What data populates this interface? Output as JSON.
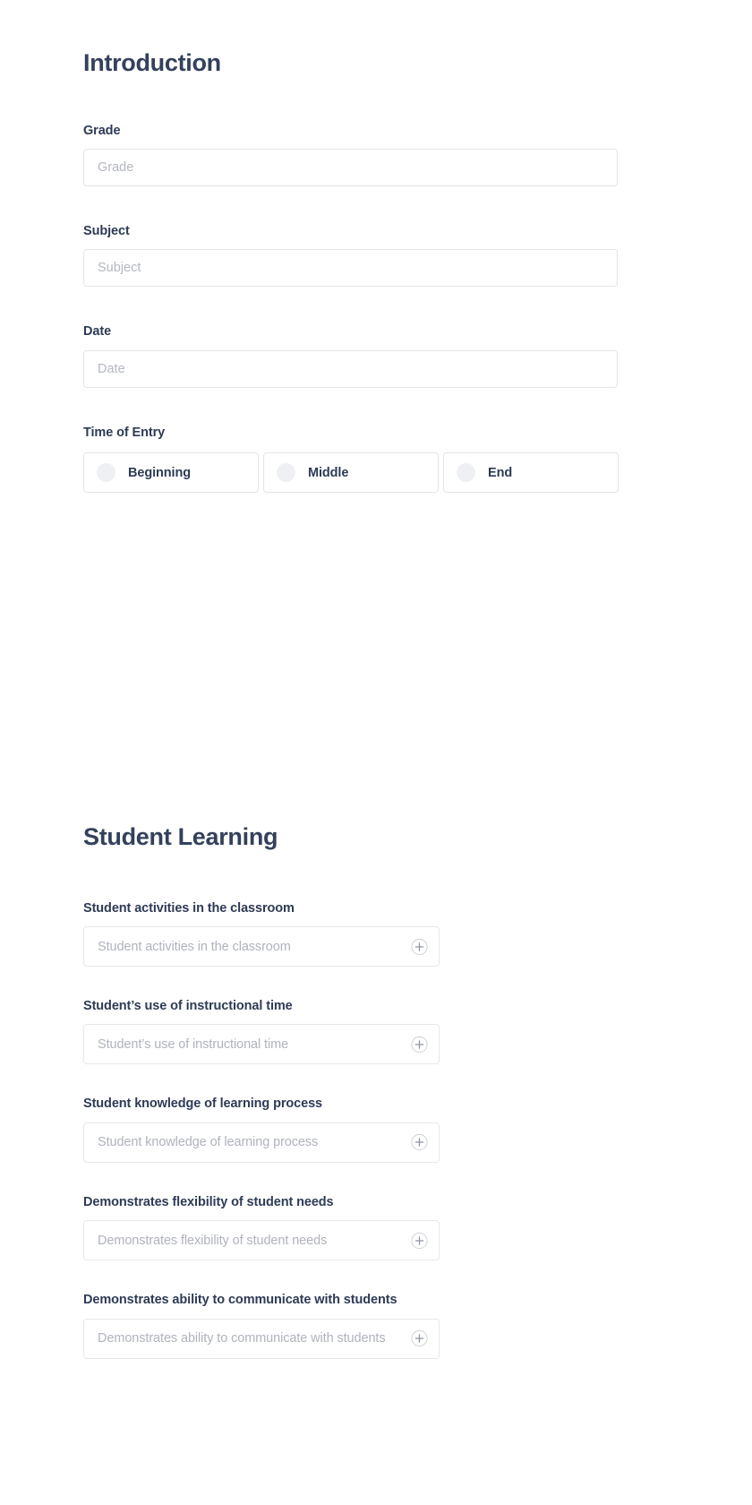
{
  "sections": [
    {
      "id": "introduction",
      "title": "Introduction",
      "fields": [
        {
          "label": "Grade",
          "placeholder": "Grade",
          "value": ""
        },
        {
          "label": "Subject",
          "placeholder": "Subject",
          "value": ""
        },
        {
          "label": "Date",
          "placeholder": "Date",
          "value": ""
        }
      ],
      "radio_group": {
        "label": "Time of Entry",
        "selected": "",
        "options": [
          {
            "label": "Beginning",
            "selected": false
          },
          {
            "label": "Middle",
            "selected": false
          },
          {
            "label": "End",
            "selected": false
          }
        ]
      }
    },
    {
      "id": "student-learning",
      "title": "Student Learning",
      "accordions": [
        {
          "label": "Student activities in the classroom",
          "placeholder": "Student activities in the classroom",
          "icon": "plus-circle-icon",
          "expanded": false
        },
        {
          "label": "Student’s use of instructional time",
          "placeholder": "Student’s use of instructional time",
          "icon": "plus-circle-icon",
          "expanded": false
        },
        {
          "label": "Student knowledge of learning process",
          "placeholder": "Student knowledge of learning process",
          "icon": "plus-circle-icon",
          "expanded": false
        },
        {
          "label": "Demonstrates flexibility of student needs",
          "placeholder": "Demonstrates flexibility of student needs",
          "icon": "plus-circle-icon",
          "expanded": false
        },
        {
          "label": "Demonstrates ability to communicate with students",
          "placeholder": "Demonstrates ability to communicate with students",
          "icon": "plus-circle-icon",
          "expanded": false
        }
      ]
    }
  ],
  "colors": {
    "heading": "#33415c",
    "label": "#2e3b55",
    "placeholder": "#b4b7c0",
    "border": "#e3e4e8",
    "radio_dot": "#eff0f3",
    "background": "#ffffff"
  }
}
